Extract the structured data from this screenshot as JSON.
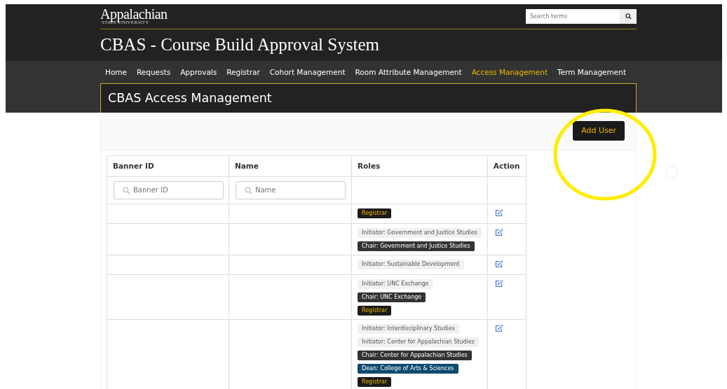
{
  "header": {
    "logo": "Appalachian",
    "logo_sub": "STATE UNIVERSITY",
    "search": {
      "placeholder": "Search terms"
    }
  },
  "app_title": "CBAS - Course Build Approval System",
  "nav": [
    {
      "label": "Home",
      "selected": false
    },
    {
      "label": "Requests",
      "selected": false
    },
    {
      "label": "Approvals",
      "selected": false
    },
    {
      "label": "Registrar",
      "selected": false
    },
    {
      "label": "Cohort Management",
      "selected": false
    },
    {
      "label": "Room Attribute Management",
      "selected": false
    },
    {
      "label": "Access Management",
      "selected": true
    },
    {
      "label": "Term Management",
      "selected": false
    }
  ],
  "page_title": "CBAS Access Management",
  "add_button": "Add User",
  "table": {
    "columns": [
      "Banner ID",
      "Name",
      "Roles",
      "Action"
    ],
    "filters": [
      {
        "placeholder": "Banner ID"
      },
      {
        "placeholder": "Name"
      }
    ],
    "rows": [
      {
        "roles": [
          {
            "kind": "registrar",
            "label": "Registrar"
          }
        ]
      },
      {
        "roles": [
          {
            "kind": "initiator",
            "label": "Initiator: Government and Justice Studies"
          },
          {
            "kind": "chair",
            "label": "Chair: Government and Justice Studies"
          }
        ]
      },
      {
        "roles": [
          {
            "kind": "initiator",
            "label": "Initiator: Sustainable Development"
          }
        ]
      },
      {
        "roles": [
          {
            "kind": "initiator",
            "label": "Initiator: UNC Exchange"
          },
          {
            "kind": "chair",
            "label": "Chair: UNC Exchange"
          },
          {
            "kind": "registrar",
            "label": "Registrar"
          }
        ]
      },
      {
        "roles": [
          {
            "kind": "initiator",
            "label": "Initiator: Interdisciplinary Studies"
          },
          {
            "kind": "initiator",
            "label": "Initiator: Center for Appalachian Studies"
          },
          {
            "kind": "chair",
            "label": "Chair: Center for Appalachian Studies"
          },
          {
            "kind": "dean",
            "label": "Dean: College of Arts & Sciences"
          },
          {
            "kind": "registrar",
            "label": "Registrar"
          }
        ]
      }
    ]
  }
}
